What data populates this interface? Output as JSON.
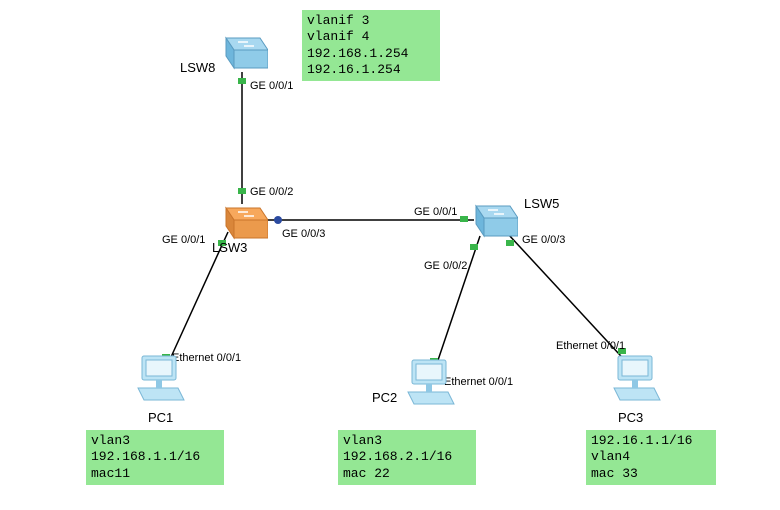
{
  "devices": {
    "lsw8": {
      "label": "LSW8"
    },
    "lsw3": {
      "label": "LSW3"
    },
    "lsw5": {
      "label": "LSW5"
    },
    "pc1": {
      "label": "PC1"
    },
    "pc2": {
      "label": "PC2"
    },
    "pc3": {
      "label": "PC3"
    }
  },
  "ports": {
    "lsw8_ge001": "GE 0/0/1",
    "lsw3_ge001": "GE 0/0/1",
    "lsw3_ge002": "GE 0/0/2",
    "lsw3_ge003": "GE 0/0/3",
    "lsw5_ge001": "GE 0/0/1",
    "lsw5_ge002": "GE 0/0/2",
    "lsw5_ge003": "GE 0/0/3",
    "pc1_eth001": "Ethernet 0/0/1",
    "pc2_eth001": "Ethernet 0/0/1",
    "pc3_eth001": "Ethernet 0/0/1"
  },
  "infoboxes": {
    "top": {
      "line1": "vlanif 3",
      "line2": "vlanif 4",
      "line3": "192.168.1.254",
      "line4": "192.16.1.254"
    },
    "pc1": {
      "line1": "vlan3",
      "line2": "192.168.1.1/16",
      "line3": "mac11"
    },
    "pc2": {
      "line1": "vlan3",
      "line2": "192.168.2.1/16",
      "line3": "mac 22"
    },
    "pc3": {
      "line1": "192.16.1.1/16",
      "line2": "vlan4",
      "line3": "mac 33"
    }
  },
  "colors": {
    "infobox_bg": "#94e794",
    "switch_blue_top": "#a8d8f0",
    "switch_blue_side": "#6eb6dc",
    "switch_orange_top": "#f7a85c",
    "switch_orange_side": "#d9863a",
    "pc_body": "#bde4f5",
    "pc_shade": "#8fc8e5",
    "port_dot": "#39b54a",
    "endpoint_dot": "#2b4aa0"
  }
}
